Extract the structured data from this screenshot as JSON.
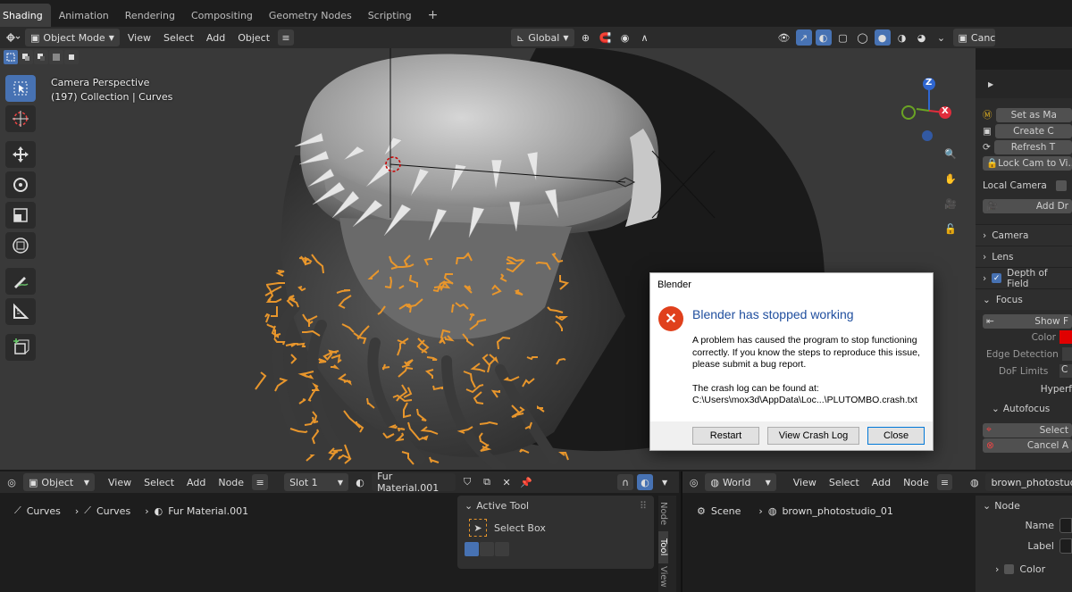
{
  "workspace_tabs": [
    "Shading",
    "Animation",
    "Rendering",
    "Compositing",
    "Geometry Nodes",
    "Scripting"
  ],
  "add_tab": "+",
  "viewport_header": {
    "mode": "Object Mode",
    "menus": [
      "View",
      "Select",
      "Add",
      "Object"
    ],
    "orientation": "Global",
    "camera_cut": "Canc"
  },
  "viewport": {
    "view_name": "Camera Perspective",
    "collection_info": "(197) Collection | Curves"
  },
  "nav_gizmo": {
    "z": "Z",
    "x": "X"
  },
  "npanel": {
    "buttons": [
      "Set as Ma",
      "Create C",
      "Refresh T",
      "Lock Cam to Vi..."
    ],
    "local_camera": "Local Camera",
    "add_btn": "Add Dr",
    "sections": [
      "Camera",
      "Lens",
      "Depth of Field",
      "Focus"
    ],
    "show_btn": "Show F",
    "color_label": "Color",
    "edge_detection": "Edge Detection",
    "dof_limits": "DoF Limits",
    "dof_limits_val": "C",
    "hyperf": "Hyperf",
    "autofocus": "Autofocus",
    "select_btn": "Select",
    "cancel_btn": "Cancel A",
    "focus_color": "#e00000"
  },
  "dialog": {
    "title": "Blender",
    "heading": "Blender has stopped working",
    "message": "A problem has caused the program to stop functioning correctly. If you know the steps to reproduce this issue, please submit a bug report.",
    "log_line": "The crash log can be found at:",
    "log_path": "C:\\Users\\mox3d\\AppData\\Loc...\\PLUTOMBO.crash.txt",
    "buttons": {
      "restart": "Restart",
      "view_log": "View Crash Log",
      "close": "Close"
    },
    "heading_color": "#1f4e9e",
    "error_color": "#e0401c"
  },
  "shader_editor": {
    "type": "Object",
    "menus": [
      "View",
      "Select",
      "Add",
      "Node"
    ],
    "slot": "Slot 1",
    "material": "Fur Material.001",
    "breadcrumb": [
      "Curves",
      "Curves",
      "Fur Material.001"
    ],
    "active_tool_title": "Active Tool",
    "active_tool_item": "Select Box",
    "side_tabs": [
      "Node",
      "Tool",
      "View"
    ]
  },
  "world_editor": {
    "type": "World",
    "menus": [
      "View",
      "Select",
      "Add",
      "Node"
    ],
    "world": "brown_photostudio",
    "breadcrumb": [
      "Scene",
      "brown_photostudio_01"
    ],
    "panel_title": "Node",
    "name_label": "Name",
    "label_label": "Label",
    "color_label": "Color"
  },
  "colors": {
    "accent": "#4772b3",
    "hair": "#e8962c",
    "red_axis": "#e02d3c",
    "green_axis": "#6aa324",
    "blue_axis": "#2f66d0"
  }
}
